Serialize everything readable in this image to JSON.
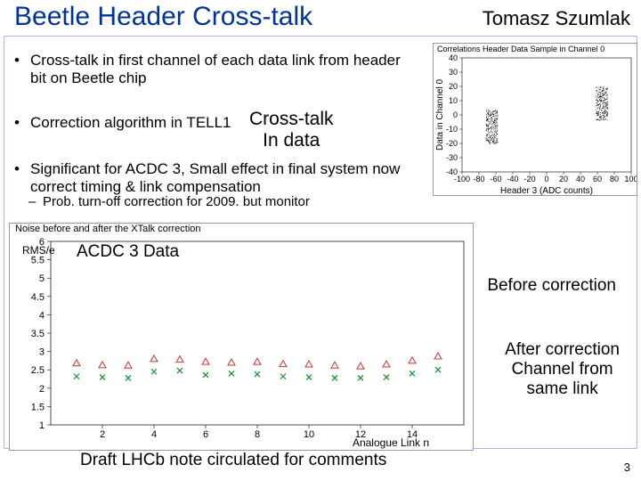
{
  "title": "Beetle Header Cross-talk",
  "author": "Tomasz Szumlak",
  "bullets": {
    "b1": "Cross-talk in first channel of each data link from header bit on Beetle chip",
    "b2": "Correction algorithm in TELL1",
    "b3": "Significant for ACDC 3, Small effect in final system now correct timing & link compensation",
    "sub": "Prob. turn-off correction for 2009. but monitor"
  },
  "annotations": {
    "crosstalk_l1": "Cross-talk",
    "crosstalk_l2": "In data",
    "acdc": "ACDC 3 Data",
    "before": "Before correction",
    "after1": "After correction",
    "after2": "Channel from",
    "after3": "same link"
  },
  "footer": "Draft LHCb note circulated for comments",
  "page_number": "3",
  "chart_data": [
    {
      "type": "scatter",
      "title": "Correlations Header  Data Sample in Channel 0",
      "xlabel": "Header 3 (ADC counts)",
      "ylabel": "Data in Channel 0",
      "xlim": [
        -100,
        100
      ],
      "ylim": [
        -40,
        40
      ],
      "xticks": [
        -100,
        -80,
        -60,
        -40,
        -20,
        0,
        20,
        40,
        60,
        80,
        100
      ],
      "yticks": [
        -40,
        -30,
        -20,
        -10,
        0,
        10,
        20,
        30,
        40
      ],
      "clusters": [
        {
          "cx": -65,
          "cy": -8,
          "sx": 7,
          "sy": 12,
          "n": 260
        },
        {
          "cx": 65,
          "cy": 8,
          "sx": 7,
          "sy": 12,
          "n": 260
        }
      ]
    },
    {
      "type": "scatter",
      "title": "Noise before and after the XTalk correction",
      "xlabel": "Analogue Link n",
      "ylabel": "RMS/e",
      "xlim": [
        0,
        16
      ],
      "ylim": [
        1,
        6
      ],
      "xticks": [
        2,
        4,
        6,
        8,
        10,
        12,
        14
      ],
      "yticks": [
        1,
        1.5,
        2,
        2.5,
        3,
        3.5,
        4,
        4.5,
        5,
        5.5,
        6
      ],
      "series": [
        {
          "name": "before",
          "marker": "triangle",
          "color": "#d03030",
          "x": [
            1,
            2,
            3,
            4,
            5,
            6,
            7,
            8,
            9,
            10,
            11,
            12,
            13,
            14,
            15
          ],
          "y": [
            2.68,
            2.63,
            2.62,
            2.8,
            2.78,
            2.72,
            2.7,
            2.72,
            2.66,
            2.65,
            2.62,
            2.6,
            2.65,
            2.75,
            2.87
          ]
        },
        {
          "name": "after_ch_from_same_link",
          "marker": "cross",
          "color": "#109030",
          "x": [
            1,
            2,
            3,
            4,
            5,
            6,
            7,
            8,
            9,
            10,
            11,
            12,
            13,
            14,
            15
          ],
          "y": [
            2.32,
            2.3,
            2.28,
            2.45,
            2.48,
            2.36,
            2.4,
            2.38,
            2.32,
            2.3,
            2.28,
            2.28,
            2.3,
            2.4,
            2.5
          ]
        }
      ]
    }
  ]
}
